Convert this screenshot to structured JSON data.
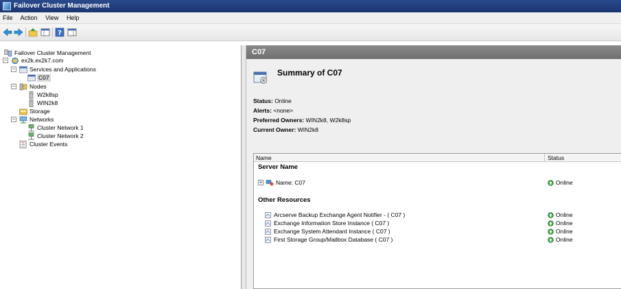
{
  "window": {
    "title": "Failover Cluster Management"
  },
  "menu": [
    "File",
    "Action",
    "View",
    "Help"
  ],
  "tree": {
    "root": "Failover Cluster Management",
    "cluster": "ex2k.ex2k7.com",
    "services": "Services and Applications",
    "service_c07": "C07",
    "nodes": "Nodes",
    "node1": "W2k8sp",
    "node2": "WIN2k8",
    "storage": "Storage",
    "networks": "Networks",
    "net1": "Cluster Network 1",
    "net2": "Cluster Network 2",
    "events": "Cluster Events"
  },
  "right": {
    "header": "C07",
    "summary_title": "Summary of C07",
    "status_label": "Status:",
    "status_value": "Online",
    "alerts_label": "Alerts:",
    "alerts_value": "<none>",
    "preferred_label": "Preferred Owners:",
    "preferred_value": "WIN2k8, W2k8sp",
    "current_label": "Current Owner:",
    "current_value": "WIN2k8"
  },
  "list": {
    "col_name": "Name",
    "col_status": "Status",
    "group_server": "Server Name",
    "server_row": {
      "name": "Name: C07",
      "status": "Online"
    },
    "group_other": "Other Resources",
    "resources": [
      {
        "name": "Arcserve Backup Exchange Agent Notifier - ( C07 )",
        "status": "Online"
      },
      {
        "name": "Exchange Information Store Instance ( C07 )",
        "status": "Online"
      },
      {
        "name": "Exchange System Attendant Instance ( C07 )",
        "status": "Online"
      },
      {
        "name": "First Storage Group/Mailbox Database ( C07 )",
        "status": "Online"
      }
    ]
  },
  "colors": {
    "titlebar": "#1b3570",
    "header_gray": "#7a7a7a",
    "online_green": "#2e9b3c"
  }
}
